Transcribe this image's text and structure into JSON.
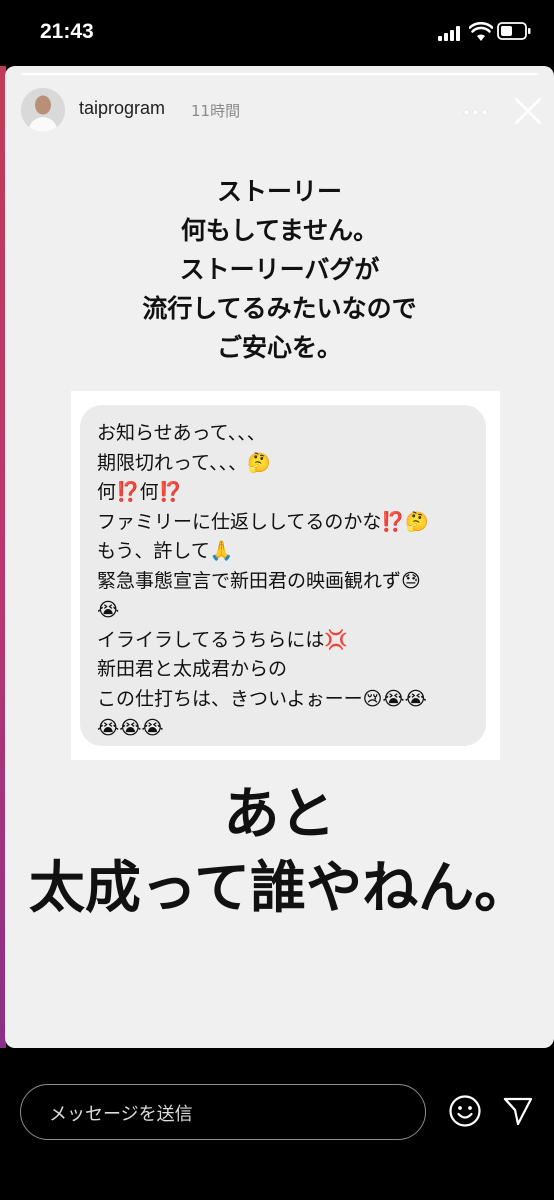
{
  "status_bar": {
    "time": "21:43",
    "icons": [
      "signal-icon",
      "wifi-icon",
      "battery-icon"
    ]
  },
  "story": {
    "username": "taiprogram",
    "time_ago": "11時間",
    "progress": 1.0,
    "headline_lines": [
      "ストーリー",
      "何もしてません。",
      "ストーリーバグが",
      "流行してるみたいなので",
      "ご安心を。"
    ],
    "embedded_message_lines": [
      "お知らせあって、、、",
      "期限切れって、、、🤔",
      "何⁉️何⁉️",
      "ファミリーに仕返ししてるのかな⁉️🤔",
      "もう、許して🙏",
      "緊急事態宣言で新田君の映画観れず😓",
      "😭",
      "イライラしてるうちらには💢",
      "新田君と太成君からの",
      "この仕打ちは、きついよぉーー😢😭😭",
      "😭😭😭"
    ],
    "big_text_lines": [
      "あと",
      "太成って誰やねん。"
    ]
  },
  "reply_bar": {
    "placeholder": "メッセージを送信",
    "icons": [
      "emoji-icon",
      "send-icon"
    ]
  },
  "colors": {
    "background": "#000000",
    "story_background": "#f0f0f0",
    "bubble": "#ebebeb",
    "text": "#111111"
  }
}
